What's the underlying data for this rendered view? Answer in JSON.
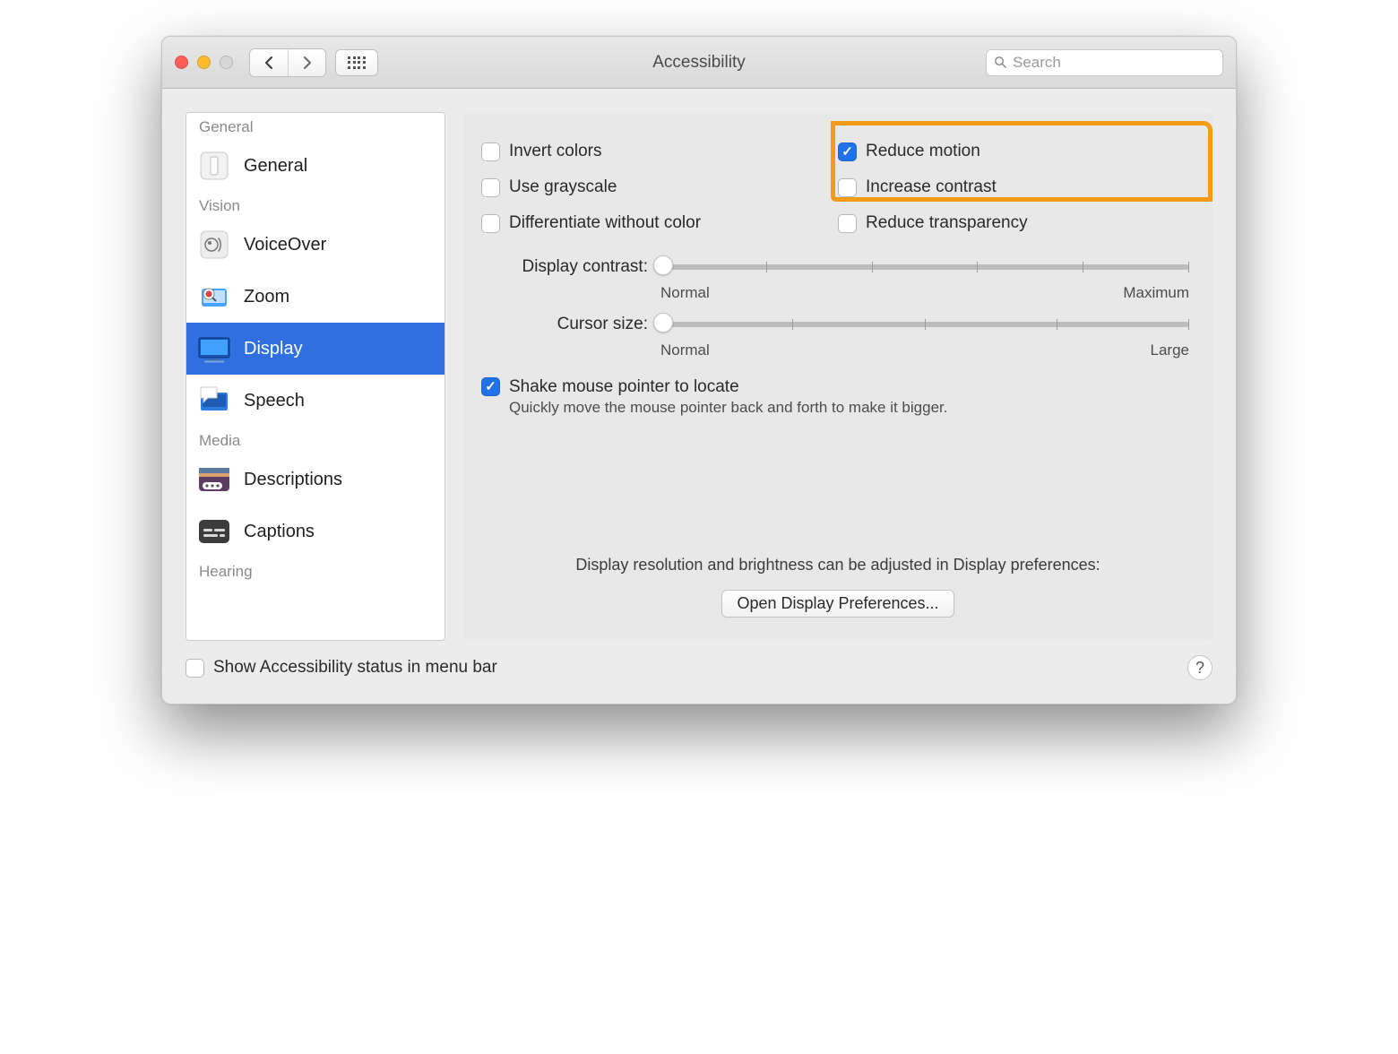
{
  "window": {
    "title": "Accessibility",
    "search_placeholder": "Search"
  },
  "sidebar": {
    "sections": [
      {
        "label": "General",
        "items": [
          {
            "label": "General",
            "icon": "general"
          }
        ]
      },
      {
        "label": "Vision",
        "items": [
          {
            "label": "VoiceOver",
            "icon": "voiceover"
          },
          {
            "label": "Zoom",
            "icon": "zoom"
          },
          {
            "label": "Display",
            "icon": "display",
            "selected": true
          },
          {
            "label": "Speech",
            "icon": "speech"
          }
        ]
      },
      {
        "label": "Media",
        "items": [
          {
            "label": "Descriptions",
            "icon": "descriptions"
          },
          {
            "label": "Captions",
            "icon": "captions"
          }
        ]
      },
      {
        "label": "Hearing",
        "items": []
      }
    ]
  },
  "panel": {
    "checks_left": [
      {
        "key": "invert_colors",
        "label": "Invert colors",
        "checked": false
      },
      {
        "key": "use_grayscale",
        "label": "Use grayscale",
        "checked": false
      },
      {
        "key": "diff_without_color",
        "label": "Differentiate without color",
        "checked": false
      }
    ],
    "checks_right": [
      {
        "key": "reduce_motion",
        "label": "Reduce motion",
        "checked": true
      },
      {
        "key": "increase_contrast",
        "label": "Increase contrast",
        "checked": false
      },
      {
        "key": "reduce_transparency",
        "label": "Reduce transparency",
        "checked": false
      }
    ],
    "highlighted_keys": [
      "reduce_motion",
      "increase_contrast"
    ],
    "sliders": {
      "contrast": {
        "label": "Display contrast:",
        "min_label": "Normal",
        "max_label": "Maximum",
        "value": 0
      },
      "cursor": {
        "label": "Cursor size:",
        "min_label": "Normal",
        "max_label": "Large",
        "value": 0
      }
    },
    "shake": {
      "checked": true,
      "title": "Shake mouse pointer to locate",
      "subtitle": "Quickly move the mouse pointer back and forth to make it bigger."
    },
    "hint": "Display resolution and brightness can be adjusted in Display preferences:",
    "open_button": "Open Display Preferences..."
  },
  "footer": {
    "menu_bar_checkbox": {
      "label": "Show Accessibility status in menu bar",
      "checked": false
    }
  }
}
